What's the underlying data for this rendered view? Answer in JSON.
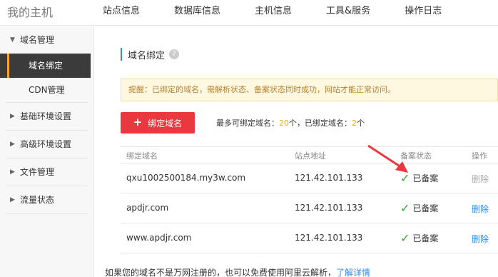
{
  "header": {
    "brand": "我的主机",
    "nav": [
      "站点信息",
      "数据库信息",
      "主机信息",
      "工具&服务",
      "操作日志"
    ]
  },
  "sidebar": {
    "groups": [
      {
        "label": "域名管理",
        "expanded": true,
        "items": [
          {
            "label": "域名绑定",
            "active": true
          },
          {
            "label": "CDN管理",
            "active": false
          }
        ]
      },
      {
        "label": "基础环境设置",
        "expanded": false,
        "items": []
      },
      {
        "label": "高级环境设置",
        "expanded": false,
        "items": []
      },
      {
        "label": "文件管理",
        "expanded": false,
        "items": []
      },
      {
        "label": "流量状态",
        "expanded": false,
        "items": []
      }
    ]
  },
  "main": {
    "title": "域名绑定",
    "help_icon": "?",
    "notice": "提醒：已绑定的域名，需解析状态、备案状态同时成功，网站才能正常访问。",
    "bind_button": "绑定域名",
    "quota": {
      "max_prefix": "最多可绑定域名：",
      "max_value": "20",
      "mid": "个，已绑定域名：",
      "bound_value": "2",
      "suffix": "个"
    },
    "table": {
      "headers": [
        "绑定域名",
        "站点地址",
        "备案状态",
        "操作"
      ],
      "rows": [
        {
          "domain": "qxu1002500184.my3w.com",
          "ip": "121.42.101.133",
          "status": "已备案",
          "op": "删除",
          "op_enabled": false
        },
        {
          "domain": "apdjr.com",
          "ip": "121.42.101.133",
          "status": "已备案",
          "op": "删除",
          "op_enabled": true
        },
        {
          "domain": "www.apdjr.com",
          "ip": "121.42.101.133",
          "status": "已备案",
          "op": "删除",
          "op_enabled": true
        }
      ]
    },
    "footnote": {
      "text": "如果您的域名不是万网注册的，也可以免费使用阿里云解析，",
      "link": "了解详情"
    }
  },
  "colors": {
    "accent_red": "#e9383e",
    "link_blue": "#2d8cf0",
    "check_green": "#3aa53a",
    "notice_text": "#b9812b",
    "active_bg": "#3b3b3b",
    "quota_orange": "#f5a623"
  },
  "icons": {
    "help": "help-icon",
    "plus": "plus-icon",
    "check": "check-icon",
    "caret_down": "caret-down-icon",
    "caret_right": "caret-right-icon"
  }
}
